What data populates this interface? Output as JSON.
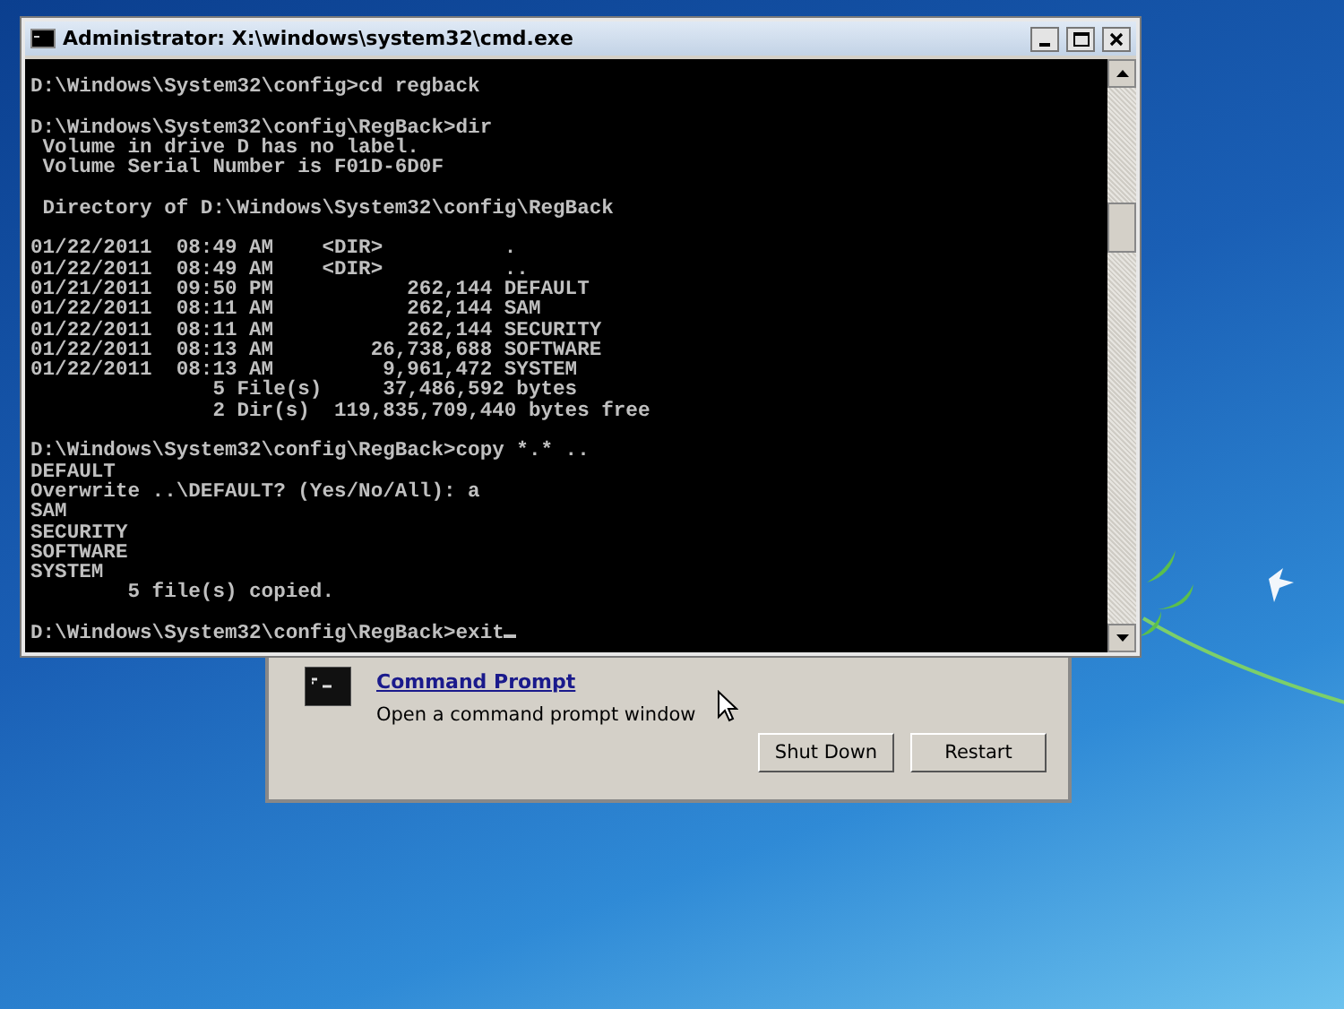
{
  "console_window": {
    "title": "Administrator: X:\\windows\\system32\\cmd.exe",
    "cursor": true,
    "blocks": [
      [
        "D:\\Windows\\System32\\config>cd regback"
      ],
      [
        "D:\\Windows\\System32\\config\\RegBack>dir",
        " Volume in drive D has no label.",
        " Volume Serial Number is F01D-6D0F"
      ],
      [
        " Directory of D:\\Windows\\System32\\config\\RegBack"
      ],
      [
        "01/22/2011  08:49 AM    <DIR>          .",
        "01/22/2011  08:49 AM    <DIR>          ..",
        "01/21/2011  09:50 PM           262,144 DEFAULT",
        "01/22/2011  08:11 AM           262,144 SAM",
        "01/22/2011  08:11 AM           262,144 SECURITY",
        "01/22/2011  08:13 AM        26,738,688 SOFTWARE",
        "01/22/2011  08:13 AM         9,961,472 SYSTEM",
        "               5 File(s)     37,486,592 bytes",
        "               2 Dir(s)  119,835,709,440 bytes free"
      ],
      [
        "D:\\Windows\\System32\\config\\RegBack>copy *.* ..",
        "DEFAULT",
        "Overwrite ..\\DEFAULT? (Yes/No/All): a",
        "SAM",
        "SECURITY",
        "SOFTWARE",
        "SYSTEM",
        "        5 file(s) copied."
      ],
      [
        "D:\\Windows\\System32\\config\\RegBack>exit"
      ]
    ]
  },
  "recovery_dialog": {
    "tool": {
      "title": "Command Prompt",
      "description": "Open a command prompt window"
    },
    "buttons": [
      "Shut Down",
      "Restart"
    ]
  }
}
